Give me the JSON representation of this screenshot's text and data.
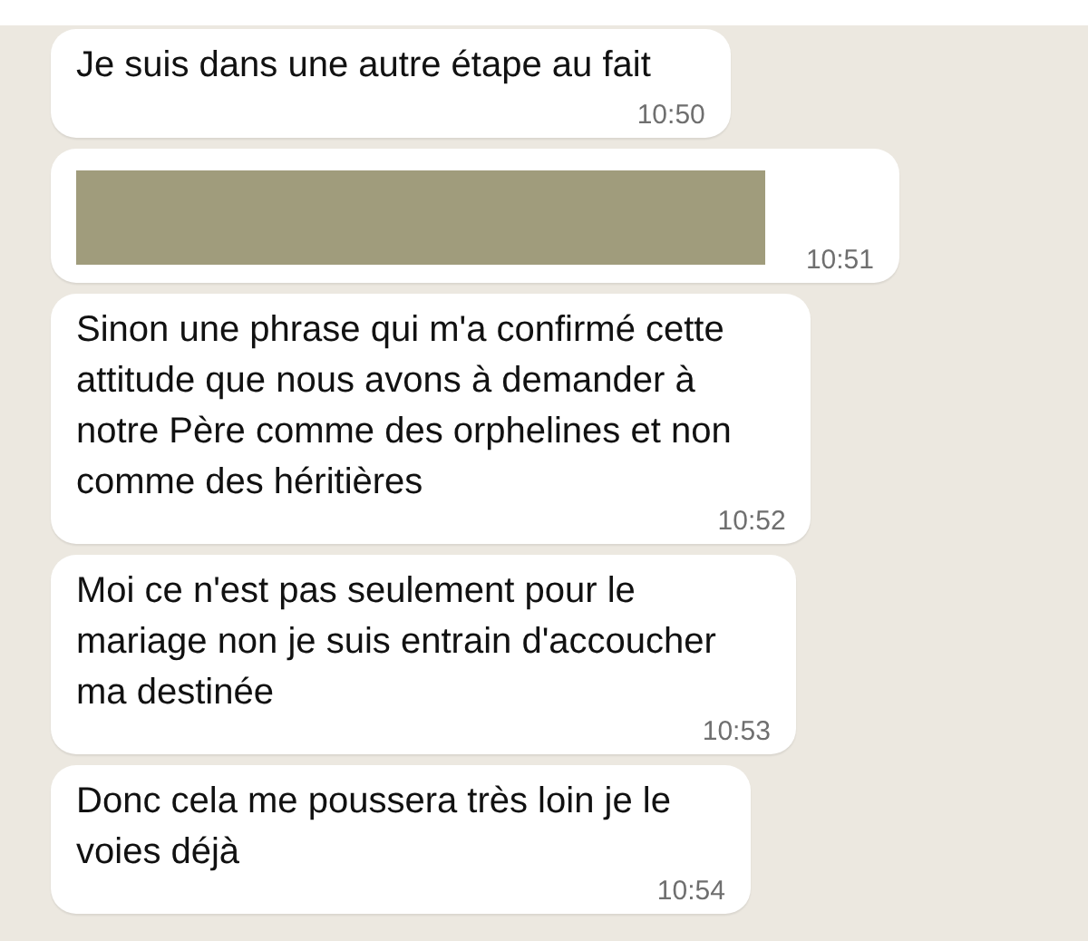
{
  "messages": [
    {
      "kind": "text",
      "text": "Je suis dans une autre étape au fait",
      "time": "10:50"
    },
    {
      "kind": "redacted",
      "time": "10:51"
    },
    {
      "kind": "text",
      "text": "Sinon une phrase qui m'a confirmé cette\nattitude que nous avons à demander à\nnotre Père comme des orphelines et non\ncomme des héritières",
      "time": "10:52"
    },
    {
      "kind": "text",
      "text": "Moi ce n'est pas seulement pour le\nmariage non je suis entrain d'accoucher\nma destinée",
      "time": "10:53"
    },
    {
      "kind": "text",
      "text": "Donc cela me poussera très loin je le\nvoies déjà",
      "time": "10:54"
    }
  ]
}
